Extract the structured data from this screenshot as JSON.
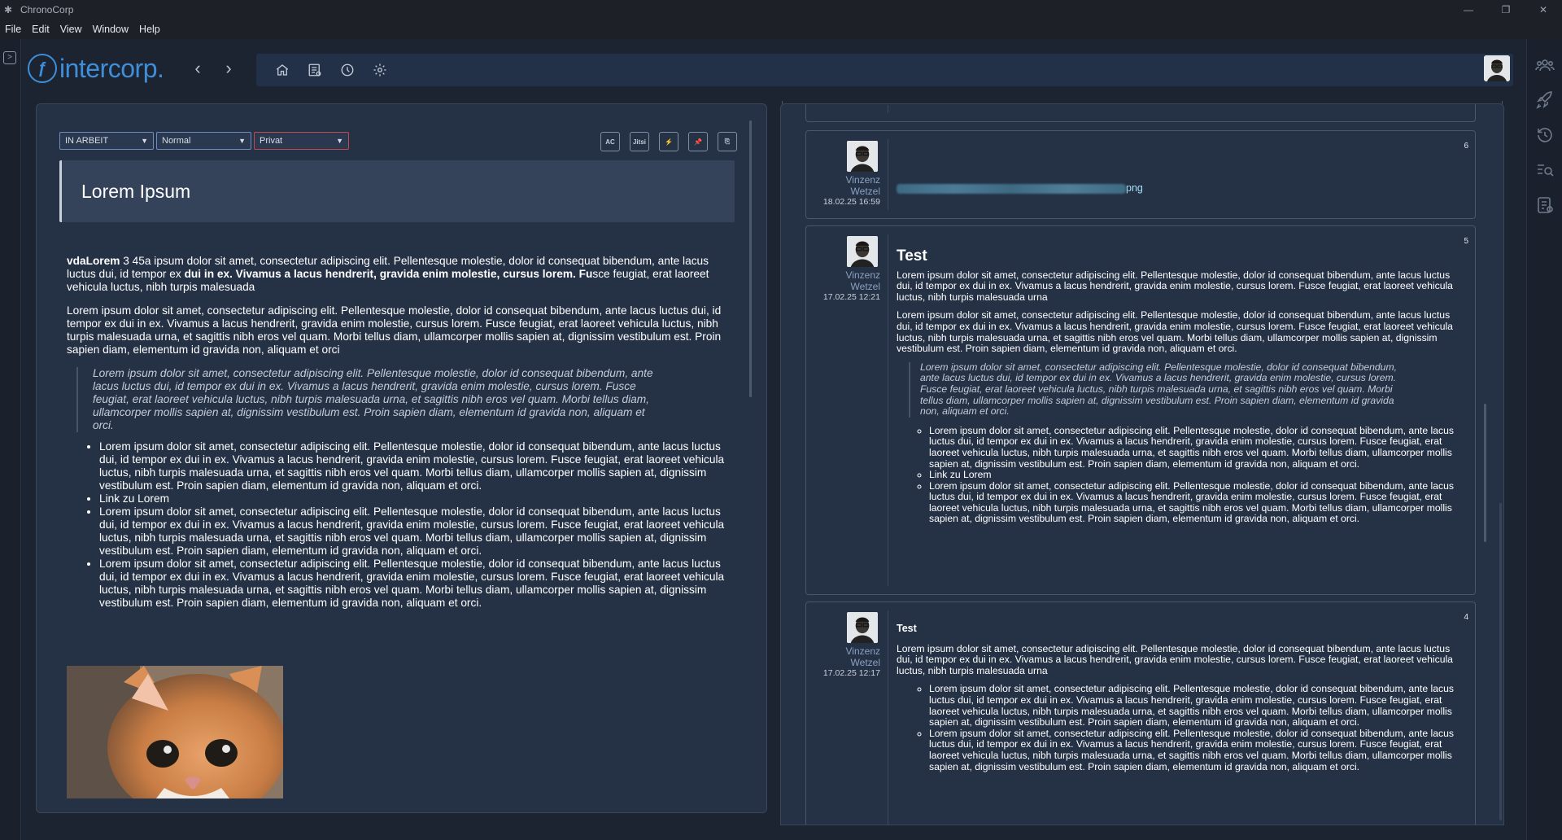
{
  "window": {
    "title": "ChronoCorp",
    "controls": {
      "minimize": "—",
      "restore": "❐",
      "close": "✕"
    }
  },
  "menu": [
    "File",
    "Edit",
    "View",
    "Window",
    "Help"
  ],
  "header": {
    "logo_text": "intercorp.",
    "icons": [
      "home-icon",
      "list-icon",
      "clock-icon",
      "gear-icon"
    ]
  },
  "right_rail_icons": [
    "team-icon",
    "rocket-icon",
    "history-icon",
    "search-list-icon",
    "notes-icon"
  ],
  "editor": {
    "status": "IN ARBEIT",
    "priority": "Normal",
    "visibility": "Privat",
    "tools": [
      "AC",
      "Jitsi",
      "⚡",
      "📌",
      "⎘"
    ],
    "title": "Lorem Ipsum",
    "intro_lead": "vdaLorem",
    "intro_a": " 3 45a ipsum dolor sit amet, consectetur adipiscing elit. Pellentesque molestie, dolor id consequat bibendum, ante lacus luctus dui, id tempor ex ",
    "intro_bold": "dui in ex. Vivamus a lacus hendrerit, gravida enim molestie, cursus lorem. Fu",
    "intro_b": "sce feugiat, erat laoreet vehicula luctus, nibh turpis malesuada",
    "para": "Lorem ipsum dolor sit amet, consectetur adipiscing elit. Pellentesque molestie, dolor id consequat bibendum, ante lacus luctus dui, id tempor ex dui in ex. Vivamus a lacus hendrerit, gravida enim molestie, cursus lorem. Fusce feugiat, erat laoreet vehicula luctus, nibh turpis malesuada urna, et sagittis nibh eros vel quam. Morbi tellus diam, ullamcorper mollis sapien at, dignissim vestibulum est. Proin sapien diam, elementum id gravida non, aliquam et orci",
    "quote": "Lorem ipsum dolor sit amet, consectetur adipiscing elit. Pellentesque molestie, dolor id consequat bibendum, ante lacus luctus dui, id tempor ex dui in ex. Vivamus a lacus hendrerit, gravida enim molestie, cursus lorem. Fusce feugiat, erat laoreet vehicula luctus, nibh turpis malesuada urna, et sagittis nibh eros vel quam. Morbi tellus diam, ullamcorper mollis sapien at, dignissim vestibulum est. Proin sapien diam, elementum id gravida non, aliquam et orci.",
    "list": [
      "Lorem ipsum dolor sit amet, consectetur adipiscing elit. Pellentesque molestie, dolor id consequat bibendum, ante lacus luctus dui, id tempor ex dui in ex. Vivamus a lacus hendrerit, gravida enim molestie, cursus lorem. Fusce feugiat, erat laoreet vehicula luctus, nibh turpis malesuada urna, et sagittis nibh eros vel quam. Morbi tellus diam, ullamcorper mollis sapien at, dignissim vestibulum est. Proin sapien diam, elementum id gravida non, aliquam et orci.",
      "Link zu Lorem",
      "Lorem ipsum dolor sit amet, consectetur adipiscing elit. Pellentesque molestie, dolor id consequat bibendum, ante lacus luctus dui, id tempor ex dui in ex. Vivamus a lacus hendrerit, gravida enim molestie, cursus lorem. Fusce feugiat, erat laoreet vehicula luctus, nibh turpis malesuada urna, et sagittis nibh eros vel quam. Morbi tellus diam, ullamcorper mollis sapien at, dignissim vestibulum est. Proin sapien diam, elementum id gravida non, aliquam et orci.",
      "Lorem ipsum dolor sit amet, consectetur adipiscing elit. Pellentesque molestie, dolor id consequat bibendum, ante lacus luctus dui, id tempor ex dui in ex. Vivamus a lacus hendrerit, gravida enim molestie, cursus lorem. Fusce feugiat, erat laoreet vehicula luctus, nibh turpis malesuada urna, et sagittis nibh eros vel quam. Morbi tellus diam, ullamcorper mollis sapien at, dignissim vestibulum est. Proin sapien diam, elementum id gravida non, aliquam et orci."
    ]
  },
  "comments": [
    {
      "num": "6",
      "author_first": "Vinzenz",
      "author_last": "Wetzel",
      "date": "18.02.25 16:59",
      "file_ext": "png"
    },
    {
      "num": "5",
      "author_first": "Vinzenz",
      "author_last": "Wetzel",
      "date": "17.02.25 12:21",
      "title": "Test",
      "para": "Lorem ipsum dolor sit amet, consectetur adipiscing elit. Pellentesque molestie, dolor id consequat bibendum, ante lacus luctus dui, id tempor ex dui in ex. Vivamus a lacus hendrerit, gravida enim molestie, cursus lorem. Fusce feugiat, erat laoreet vehicula luctus, nibh turpis malesuada urna",
      "para2": "Lorem ipsum dolor sit amet, consectetur adipiscing elit. Pellentesque molestie, dolor id consequat bibendum, ante lacus luctus dui, id tempor ex dui in ex. Vivamus a lacus hendrerit, gravida enim molestie, cursus lorem. Fusce feugiat, erat laoreet vehicula luctus, nibh turpis malesuada urna, et sagittis nibh eros vel quam. Morbi tellus diam, ullamcorper mollis sapien at, dignissim vestibulum est. Proin sapien diam, elementum id gravida non, aliquam et orci.",
      "quote": "Lorem ipsum dolor sit amet, consectetur adipiscing elit. Pellentesque molestie, dolor id consequat bibendum, ante lacus luctus dui, id tempor ex dui in ex. Vivamus a lacus hendrerit, gravida enim molestie, cursus lorem. Fusce feugiat, erat laoreet vehicula luctus, nibh turpis malesuada urna, et sagittis nibh eros vel quam. Morbi tellus diam, ullamcorper mollis sapien at, dignissim vestibulum est. Proin sapien diam, elementum id gravida non, aliquam et orci.",
      "list": [
        "Lorem ipsum dolor sit amet, consectetur adipiscing elit. Pellentesque molestie, dolor id consequat bibendum, ante lacus luctus dui, id tempor ex dui in ex. Vivamus a lacus hendrerit, gravida enim molestie, cursus lorem. Fusce feugiat, erat laoreet vehicula luctus, nibh turpis malesuada urna, et sagittis nibh eros vel quam. Morbi tellus diam, ullamcorper mollis sapien at, dignissim vestibulum est. Proin sapien diam, elementum id gravida non, aliquam et orci.",
        "Link zu Lorem",
        "Lorem ipsum dolor sit amet, consectetur adipiscing elit. Pellentesque molestie, dolor id consequat bibendum, ante lacus luctus dui, id tempor ex dui in ex. Vivamus a lacus hendrerit, gravida enim molestie, cursus lorem. Fusce feugiat, erat laoreet vehicula luctus, nibh turpis malesuada urna, et sagittis nibh eros vel quam. Morbi tellus diam, ullamcorper mollis sapien at, dignissim vestibulum est. Proin sapien diam, elementum id gravida non, aliquam et orci."
      ]
    },
    {
      "num": "4",
      "author_first": "Vinzenz",
      "author_last": "Wetzel",
      "date": "17.02.25 12:17",
      "title": "Test",
      "para": "Lorem ipsum dolor sit amet, consectetur adipiscing elit. Pellentesque molestie, dolor id consequat bibendum, ante lacus luctus dui, id tempor ex dui in ex. Vivamus a lacus hendrerit, gravida enim molestie, cursus lorem. Fusce feugiat, erat laoreet vehicula luctus, nibh turpis malesuada urna",
      "list": [
        "Lorem ipsum dolor sit amet, consectetur adipiscing elit. Pellentesque molestie, dolor id consequat bibendum, ante lacus luctus dui, id tempor ex dui in ex. Vivamus a lacus hendrerit, gravida enim molestie, cursus lorem. Fusce feugiat, erat laoreet vehicula luctus, nibh turpis malesuada urna, et sagittis nibh eros vel quam. Morbi tellus diam, ullamcorper mollis sapien at, dignissim vestibulum est. Proin sapien diam, elementum id gravida non, aliquam et orci.",
        "Lorem ipsum dolor sit amet, consectetur adipiscing elit. Pellentesque molestie, dolor id consequat bibendum, ante lacus luctus dui, id tempor ex dui in ex. Vivamus a lacus hendrerit, gravida enim molestie, cursus lorem. Fusce feugiat, erat laoreet vehicula luctus, nibh turpis malesuada urna, et sagittis nibh eros vel quam. Morbi tellus diam, ullamcorper mollis sapien at, dignissim vestibulum est. Proin sapien diam, elementum id gravida non, aliquam et orci."
      ]
    }
  ]
}
